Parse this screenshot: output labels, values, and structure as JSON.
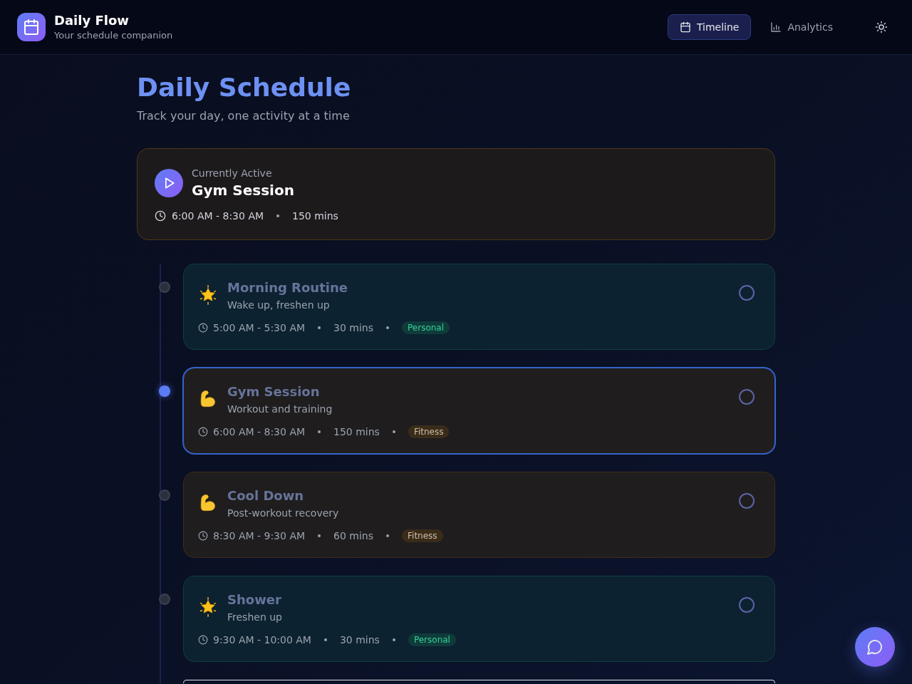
{
  "app": {
    "title": "Daily Flow",
    "subtitle": "Your schedule companion"
  },
  "nav": [
    {
      "kind": "timeline",
      "label": "Timeline",
      "selected": true
    },
    {
      "kind": "analytics",
      "label": "Analytics",
      "selected": false
    }
  ],
  "page": {
    "title": "Daily Schedule",
    "subtitle": "Track your day, one activity at a time"
  },
  "current_activity": {
    "label": "Currently Active",
    "title": "Gym Session",
    "time": "6:00 AM - 8:30 AM",
    "duration": "150 mins"
  },
  "activities": [
    {
      "kind": "personal",
      "title": "Morning Routine",
      "description": "Wake up, freshen up",
      "time": "5:00 AM - 5:30 AM",
      "duration": "30 mins",
      "category": "Personal",
      "color": "#34d399",
      "selected": false,
      "checked": false
    },
    {
      "kind": "fitness",
      "title": "Gym Session",
      "description": "Workout and training",
      "time": "6:00 AM - 8:30 AM",
      "duration": "150 mins",
      "category": "Fitness",
      "color": "#cdbfa6",
      "selected": true,
      "checked": false
    },
    {
      "kind": "fitness",
      "title": "Cool Down",
      "description": "Post-workout recovery",
      "time": "8:30 AM - 9:30 AM",
      "duration": "60 mins",
      "category": "Fitness",
      "color": "#cdbfa6",
      "selected": false,
      "checked": false
    },
    {
      "kind": "personal",
      "title": "Shower",
      "description": "Freshen up",
      "time": "9:30 AM - 10:00 AM",
      "duration": "30 mins",
      "category": "Personal",
      "color": "#34d399",
      "selected": false,
      "checked": false
    }
  ]
}
